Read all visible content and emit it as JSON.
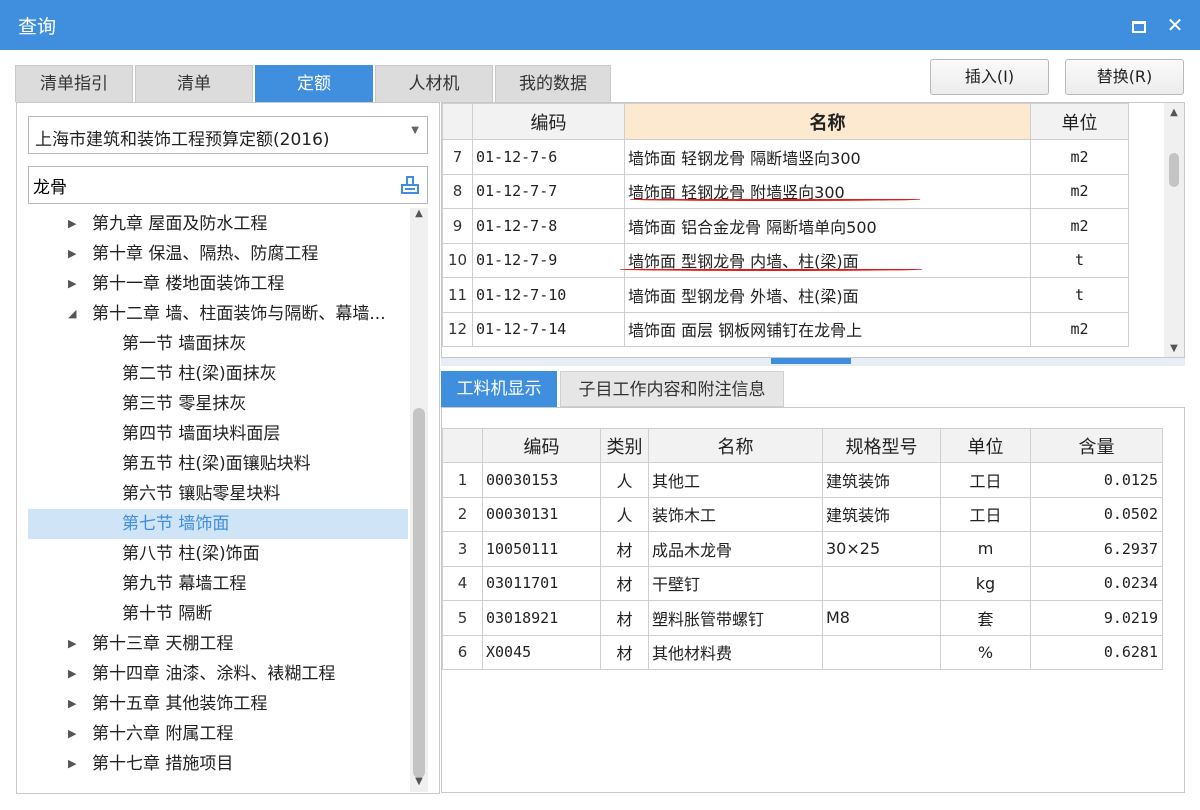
{
  "window": {
    "title": "查询"
  },
  "tabs": [
    {
      "label": "清单指引"
    },
    {
      "label": "清单"
    },
    {
      "label": "定额"
    },
    {
      "label": "人材机"
    },
    {
      "label": "我的数据"
    }
  ],
  "active_tab": "定额",
  "actions": {
    "insert_label": "插入(I)",
    "replace_label": "替换(R)"
  },
  "left": {
    "quota_library": "上海市建筑和装饰工程预算定额(2016)",
    "search_value": "龙骨",
    "tree": [
      {
        "label": "第九章 屋面及防水工程",
        "level": 0,
        "expanded": false
      },
      {
        "label": "第十章 保温、隔热、防腐工程",
        "level": 0,
        "expanded": false
      },
      {
        "label": "第十一章 楼地面装饰工程",
        "level": 0,
        "expanded": false
      },
      {
        "label": "第十二章 墙、柱面装饰与隔断、幕墙...",
        "level": 0,
        "expanded": true
      },
      {
        "label": "第一节 墙面抹灰",
        "level": 1
      },
      {
        "label": "第二节 柱(梁)面抹灰",
        "level": 1
      },
      {
        "label": "第三节 零星抹灰",
        "level": 1
      },
      {
        "label": "第四节 墙面块料面层",
        "level": 1
      },
      {
        "label": "第五节 柱(梁)面镶贴块料",
        "level": 1
      },
      {
        "label": "第六节 镶贴零星块料",
        "level": 1
      },
      {
        "label": "第七节 墙饰面",
        "level": 1,
        "selected": true
      },
      {
        "label": "第八节 柱(梁)饰面",
        "level": 1
      },
      {
        "label": "第九节 幕墙工程",
        "level": 1
      },
      {
        "label": "第十节 隔断",
        "level": 1
      },
      {
        "label": "第十三章 天棚工程",
        "level": 0,
        "expanded": false
      },
      {
        "label": "第十四章 油漆、涂料、裱糊工程",
        "level": 0,
        "expanded": false
      },
      {
        "label": "第十五章 其他装饰工程",
        "level": 0,
        "expanded": false
      },
      {
        "label": "第十六章 附属工程",
        "level": 0,
        "expanded": false
      },
      {
        "label": "第十七章 措施项目",
        "level": 0,
        "expanded": false
      }
    ]
  },
  "upper_table": {
    "headers": [
      "编码",
      "名称",
      "单位"
    ],
    "rows": [
      {
        "no": "7",
        "code": "01-12-7-6",
        "name": "墙饰面 轻钢龙骨 隔断墙竖向300",
        "unit": "m2"
      },
      {
        "no": "8",
        "code": "01-12-7-7",
        "name": "墙饰面 轻钢龙骨 附墙竖向300",
        "unit": "m2"
      },
      {
        "no": "9",
        "code": "01-12-7-8",
        "name": "墙饰面 铝合金龙骨 隔断墙单向500",
        "unit": "m2"
      },
      {
        "no": "10",
        "code": "01-12-7-9",
        "name": "墙饰面 型钢龙骨 内墙、柱(梁)面",
        "unit": "t"
      },
      {
        "no": "11",
        "code": "01-12-7-10",
        "name": "墙饰面 型钢龙骨 外墙、柱(梁)面",
        "unit": "t"
      },
      {
        "no": "12",
        "code": "01-12-7-14",
        "name": "墙饰面 面层 钢板网铺钉在龙骨上",
        "unit": "m2"
      }
    ]
  },
  "lower_tabs": [
    {
      "label": "工料机显示"
    },
    {
      "label": "子目工作内容和附注信息"
    }
  ],
  "lower_table": {
    "headers": [
      "编码",
      "类别",
      "名称",
      "规格型号",
      "单位",
      "含量"
    ],
    "rows": [
      {
        "no": "1",
        "code": "00030153",
        "type": "人",
        "name": "其他工",
        "spec": "建筑装饰",
        "unit": "工日",
        "qty": "0.0125"
      },
      {
        "no": "2",
        "code": "00030131",
        "type": "人",
        "name": "装饰木工",
        "spec": "建筑装饰",
        "unit": "工日",
        "qty": "0.0502"
      },
      {
        "no": "3",
        "code": "10050111",
        "type": "材",
        "name": "成品木龙骨",
        "spec": "30×25",
        "unit": "m",
        "qty": "6.2937"
      },
      {
        "no": "4",
        "code": "03011701",
        "type": "材",
        "name": "干壁钉",
        "spec": "",
        "unit": "kg",
        "qty": "0.0234"
      },
      {
        "no": "5",
        "code": "03018921",
        "type": "材",
        "name": "塑料胀管带螺钉",
        "spec": "M8",
        "unit": "套",
        "qty": "9.0219"
      },
      {
        "no": "6",
        "code": "X0045",
        "type": "材",
        "name": "其他材料费",
        "spec": "",
        "unit": "%",
        "qty": "0.6281"
      }
    ]
  },
  "colors": {
    "accent": "#3f8fde",
    "header_highlight": "#fde9d0",
    "annotation": "#e21b1b"
  }
}
